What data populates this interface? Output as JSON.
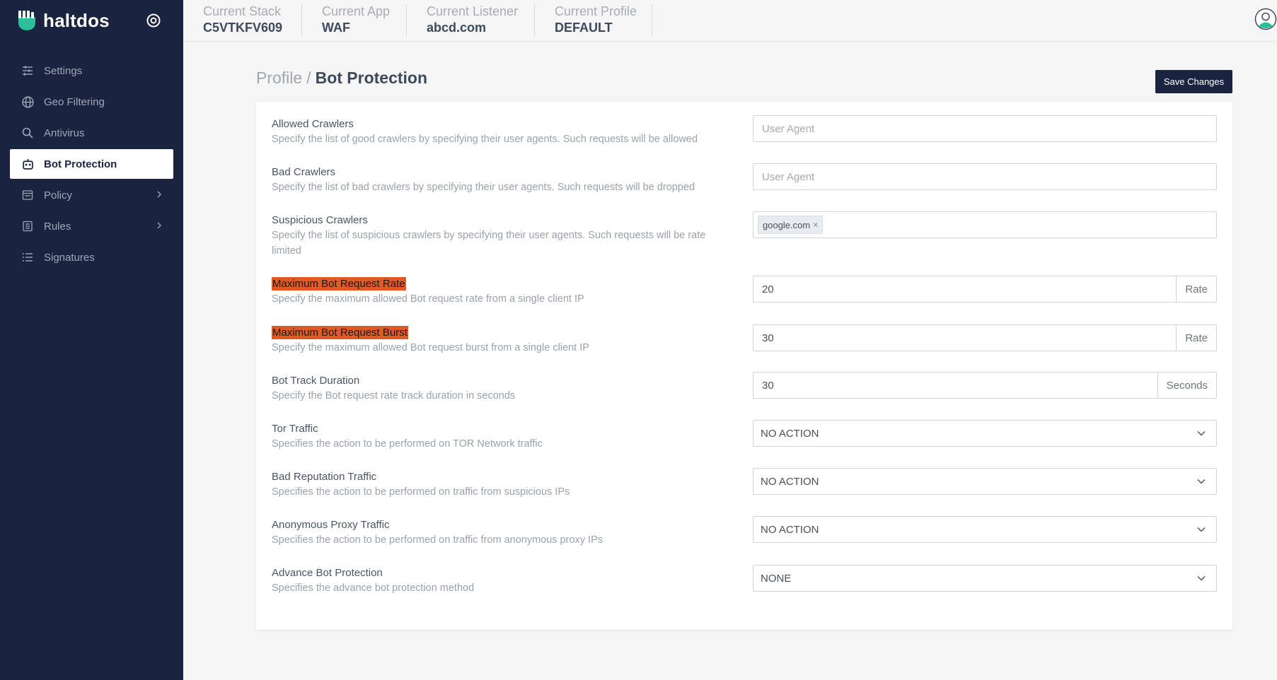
{
  "brand": {
    "name": "haltdos",
    "accent": "#2bbf9a"
  },
  "sidebar": {
    "items": [
      {
        "label": "Settings",
        "icon": "sliders-icon",
        "active": false
      },
      {
        "label": "Geo Filtering",
        "icon": "globe-icon",
        "active": false
      },
      {
        "label": "Antivirus",
        "icon": "search-icon",
        "active": false
      },
      {
        "label": "Bot Protection",
        "icon": "robot-icon",
        "active": true
      },
      {
        "label": "Policy",
        "icon": "policy-icon",
        "active": false,
        "has_submenu": true
      },
      {
        "label": "Rules",
        "icon": "rules-icon",
        "active": false,
        "has_submenu": true
      },
      {
        "label": "Signatures",
        "icon": "list-icon",
        "active": false
      }
    ]
  },
  "header": {
    "context": [
      {
        "label": "Current Stack",
        "value": "C5VTKFV609"
      },
      {
        "label": "Current App",
        "value": "WAF"
      },
      {
        "label": "Current Listener",
        "value": "abcd.com"
      },
      {
        "label": "Current Profile",
        "value": "DEFAULT"
      }
    ]
  },
  "page": {
    "breadcrumb_root": "Profile",
    "breadcrumb_sep": "/",
    "title": "Bot Protection",
    "save_label": "Save Changes"
  },
  "settings": {
    "allowed_crawlers": {
      "title": "Allowed Crawlers",
      "desc": "Specify the list of good crawlers by specifying their user agents. Such requests will be allowed",
      "placeholder": "User Agent"
    },
    "bad_crawlers": {
      "title": "Bad Crawlers",
      "desc": "Specify the list of bad crawlers by specifying their user agents. Such requests will be dropped",
      "placeholder": "User Agent"
    },
    "suspicious_crawlers": {
      "title": "Suspicious Crawlers",
      "desc": "Specify the list of suspicious crawlers by specifying their user agents. Such requests will be rate limited",
      "tags": [
        "google.com"
      ],
      "tag_remove": "×"
    },
    "max_rate": {
      "title": "Maximum Bot Request Rate",
      "desc": "Specify the maximum allowed Bot request rate from a single client IP",
      "value": "20",
      "unit": "Rate"
    },
    "max_burst": {
      "title": "Maximum Bot Request Burst",
      "desc": "Specify the maximum allowed Bot request burst from a single client IP",
      "value": "30",
      "unit": "Rate"
    },
    "track_duration": {
      "title": "Bot Track Duration",
      "desc": "Specify the Bot request rate track duration in seconds",
      "value": "30",
      "unit": "Seconds"
    },
    "tor_traffic": {
      "title": "Tor Traffic",
      "desc": "Specifies the action to be performed on TOR Network traffic",
      "selected": "NO ACTION"
    },
    "bad_reputation": {
      "title": "Bad Reputation Traffic",
      "desc": "Specifies the action to be performed on traffic from suspicious IPs",
      "selected": "NO ACTION"
    },
    "anonymous_proxy": {
      "title": "Anonymous Proxy Traffic",
      "desc": "Specifies the action to be performed on traffic from anonymous proxy IPs",
      "selected": "NO ACTION"
    },
    "advance_bot": {
      "title": "Advance Bot Protection",
      "desc": "Specifies the advance bot protection method",
      "selected": "NONE"
    }
  },
  "colors": {
    "sidebar_bg": "#1a2340",
    "highlight": "#e05a26",
    "save_button": "#1a2340"
  }
}
